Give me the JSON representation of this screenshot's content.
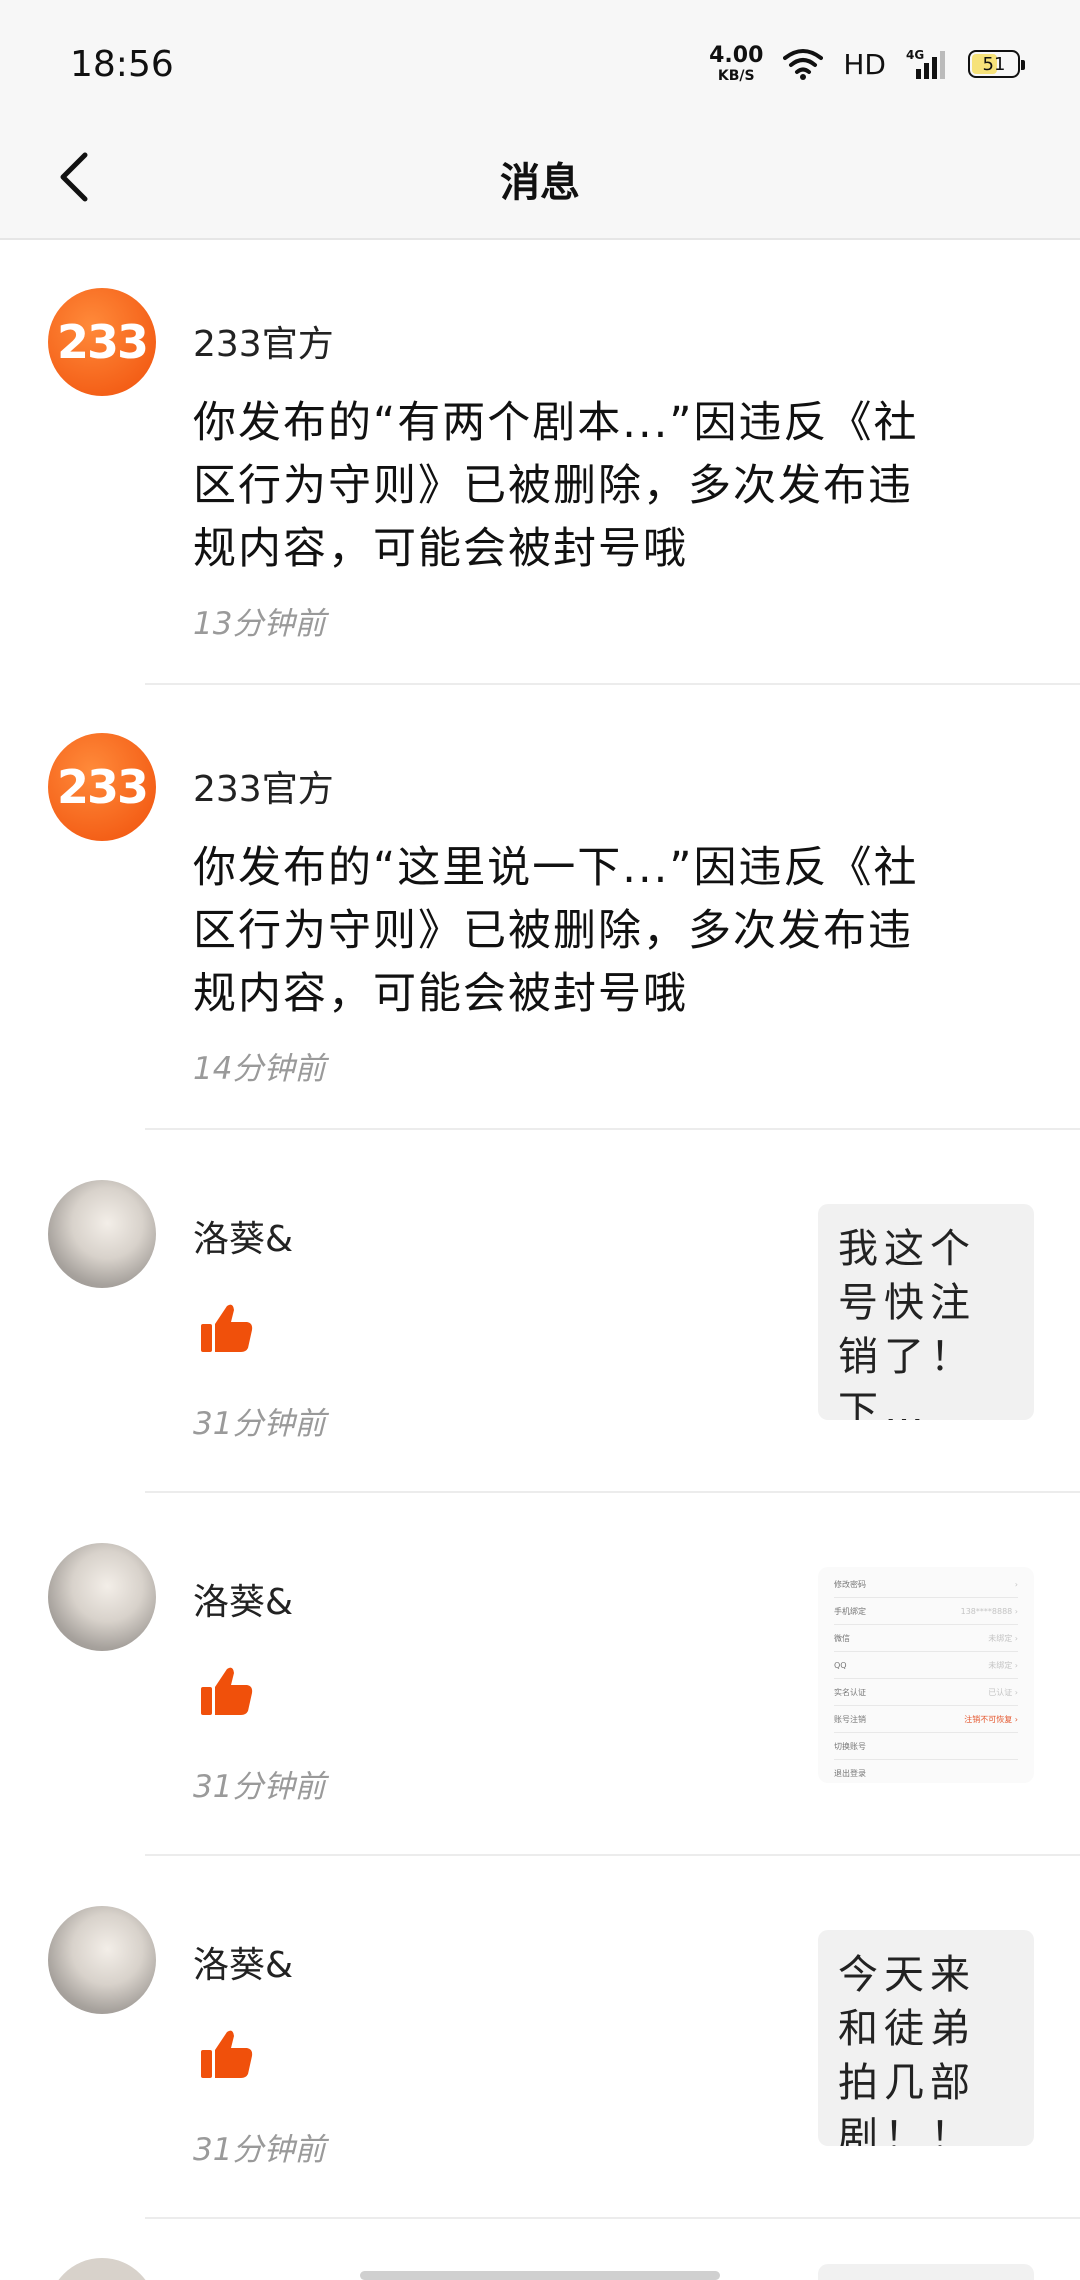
{
  "status_bar": {
    "time": "18:56",
    "net_speed_value": "4.00",
    "net_speed_unit": "KB/S",
    "hd": "HD",
    "signal": "4G",
    "battery": "51"
  },
  "header": {
    "title": "消息",
    "back_icon": "chevron-left-icon"
  },
  "messages": [
    {
      "type": "system",
      "avatar_text": "233",
      "name": "233官方",
      "content": "你发布的“有两个剧本...”因违反《社区行为守则》已被删除，多次发布违规内容，可能会被封号哦",
      "time": "13分钟前"
    },
    {
      "type": "system",
      "avatar_text": "233",
      "name": "233官方",
      "content": "你发布的“这里说一下...”因违反《社区行为守则》已被删除，多次发布违规内容，可能会被封号哦",
      "time": "14分钟前"
    },
    {
      "type": "like",
      "name": "洛葵&",
      "time": "31分钟前",
      "thumb_text": "我这个号快注销了！下…"
    },
    {
      "type": "like",
      "name": "洛葵&",
      "time": "31分钟前",
      "thumb_rows": [
        {
          "label": "修改密码",
          "value": "›"
        },
        {
          "label": "手机绑定",
          "value": "138****8888 ›"
        },
        {
          "label": "微信",
          "value": "未绑定 ›"
        },
        {
          "label": "QQ",
          "value": "未绑定 ›"
        },
        {
          "label": "实名认证",
          "value": "已认证 ›"
        },
        {
          "label": "账号注销",
          "value": "注销不可恢复 ›"
        },
        {
          "label": "切换账号",
          "value": ""
        },
        {
          "label": "退出登录",
          "value": ""
        }
      ]
    },
    {
      "type": "like",
      "name": "洛葵&",
      "time": "31分钟前",
      "thumb_text": "今天来和徒弟拍几部剧！！"
    }
  ],
  "colors": {
    "accent": "#f0500b",
    "time_text": "#9a9a9a",
    "background": "#ffffff",
    "header_bg": "#f7f7f7"
  }
}
